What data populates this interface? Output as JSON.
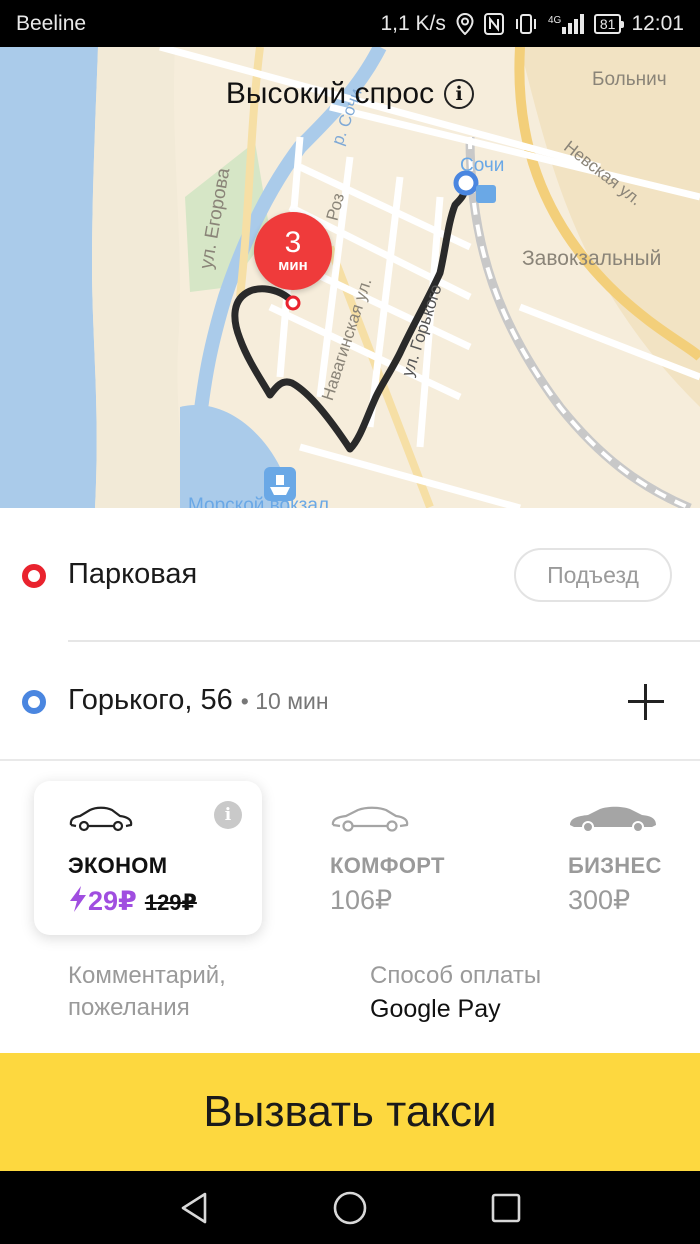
{
  "status_bar": {
    "carrier": "Beeline",
    "speed": "1,1 K/s",
    "battery": "81",
    "time": "12:01",
    "icons": [
      "location-icon",
      "nfc-icon",
      "vibrate-icon",
      "signal-4g-icon"
    ]
  },
  "map": {
    "demand_label": "Высокий спрос",
    "eta_number": "3",
    "eta_unit": "мин",
    "labels": {
      "egorova": "ул. Егорова",
      "sochi": "Сочи",
      "nevskaya": "Невская ул.",
      "bolnich": "Больнич",
      "zavokzalny": "Завокзальный",
      "navaginskaya": "Навагинская ул.",
      "gorkogo": "ул. Горького",
      "roz": "Роз",
      "river": "р. Сочи",
      "seaport": "Морской вокзал"
    }
  },
  "route": {
    "from": "Парковая",
    "entrance_button": "Подъезд",
    "to": "Горького, 56",
    "to_meta": "• 10 мин"
  },
  "tariffs": [
    {
      "name": "ЭКОНОМ",
      "price": "29₽",
      "old_price": "129₽",
      "selected": true
    },
    {
      "name": "КОМФОРТ",
      "price": "106₽",
      "selected": false
    },
    {
      "name": "БИЗНЕС",
      "price": "300₽",
      "selected": false
    }
  ],
  "options": {
    "comment": "Комментарий, пожелания",
    "payment_label": "Способ оплаты",
    "payment_value": "Google Pay"
  },
  "call_button": "Вызвать такси",
  "colors": {
    "accent_yellow": "#fdd83f",
    "pin_red": "#e9232e",
    "pin_blue": "#4a86e0",
    "promo_purple": "#a04ee0",
    "eta_red": "#ef3b3b"
  }
}
